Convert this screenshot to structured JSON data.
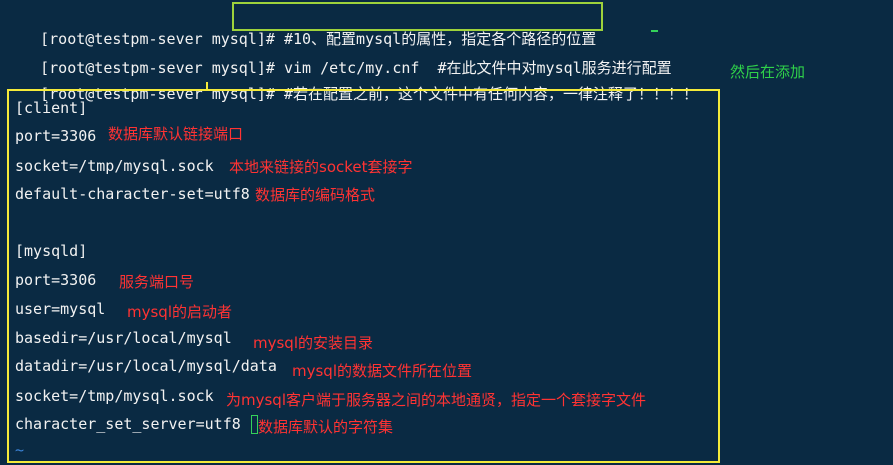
{
  "terminal": {
    "lines": [
      {
        "prompt": "[root@testpm-sever mysql]#",
        "command": " #10、配置mysql的属性，指定各个路径的位置"
      },
      {
        "prompt": "[root@testpm-sever mysql]#",
        "command": " vim /etc/my.cnf  #在此文件中对mysql服务进行配置"
      },
      {
        "prompt": "[root@testpm-sever mysql]#",
        "command": " #若在配置之前，这个文件中有任何内容，一律注释了！！！！"
      }
    ],
    "side_note": "然后在添加",
    "tilde": "~"
  },
  "config": {
    "lines": [
      {
        "text": "[client]",
        "note": ""
      },
      {
        "text": "port=3306",
        "note": "数据库默认链接端口"
      },
      {
        "text": "socket=/tmp/mysql.sock",
        "note": "本地来链接的socket套接字"
      },
      {
        "text": "default-character-set=utf8",
        "note": "数据库的编码格式"
      },
      {
        "text": "",
        "note": ""
      },
      {
        "text": "[mysqld]",
        "note": ""
      },
      {
        "text": "port=3306",
        "note": "服务端口号"
      },
      {
        "text": "user=mysql",
        "note": "mysql的启动者"
      },
      {
        "text": "basedir=/usr/local/mysql",
        "note": "mysql的安装目录"
      },
      {
        "text": "datadir=/usr/local/mysql/data",
        "note": "mysql的数据文件所在位置"
      },
      {
        "text": "socket=/tmp/mysql.sock",
        "note": "为mysql客户端于服务器之间的本地通贤，指定一个套接字文件"
      },
      {
        "text": "character_set_server=utf8",
        "note": "数据库默认的字符集"
      }
    ]
  },
  "colors": {
    "background": "#0a2a43",
    "text": "#f2f2f2",
    "annotation_red": "#ff3333",
    "annotation_green": "#2fd14a",
    "box_yellow": "#f4ea3a",
    "box_green": "#9ed23b"
  }
}
